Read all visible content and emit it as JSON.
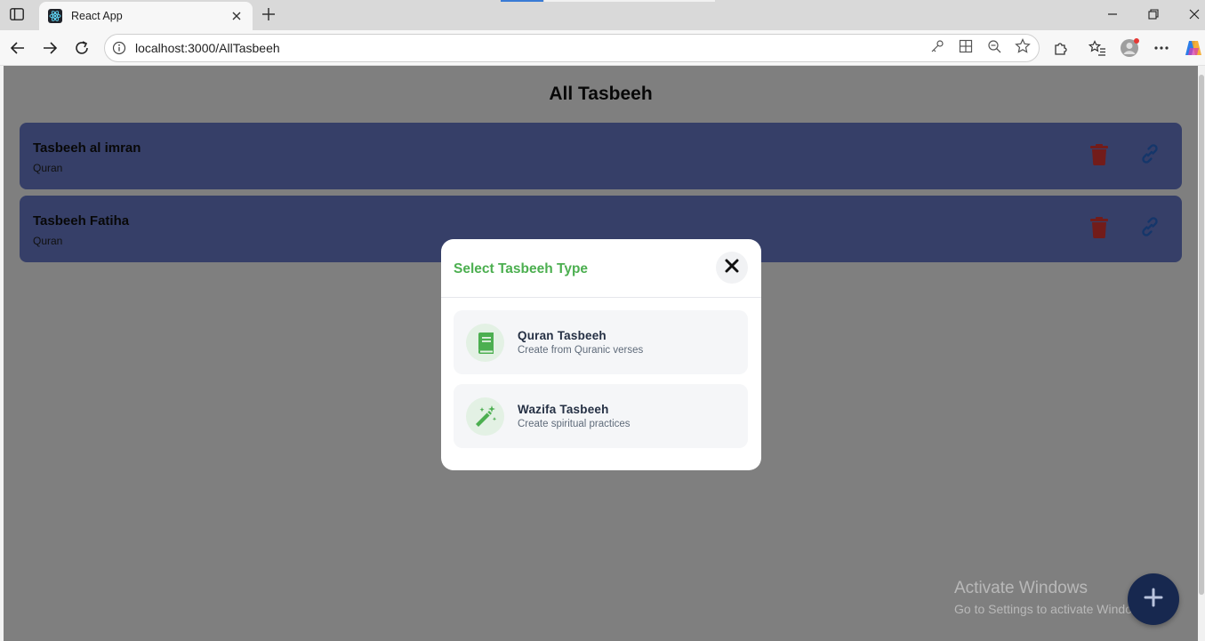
{
  "browser": {
    "tab_title": "React App",
    "url": "localhost:3000/AllTasbeeh"
  },
  "page": {
    "title": "All Tasbeeh",
    "cards": [
      {
        "name": "Tasbeeh al imran",
        "category": "Quran"
      },
      {
        "name": "Tasbeeh Fatiha",
        "category": "Quran"
      }
    ]
  },
  "modal": {
    "title": "Select Tasbeeh Type",
    "options": [
      {
        "title": "Quran Tasbeeh",
        "subtitle": "Create from Quranic verses",
        "icon": "book-icon"
      },
      {
        "title": "Wazifa Tasbeeh",
        "subtitle": "Create spiritual practices",
        "icon": "magic-wand-icon"
      }
    ]
  },
  "watermark": {
    "line1": "Activate Windows",
    "line2": "Go to Settings to activate Windows."
  },
  "colors": {
    "accent_green": "#4caf50",
    "card_bg": "#6d7fd1",
    "trash_red": "#e53935",
    "link_blue": "#2b6cd4",
    "fab_bg": "#17284f"
  }
}
